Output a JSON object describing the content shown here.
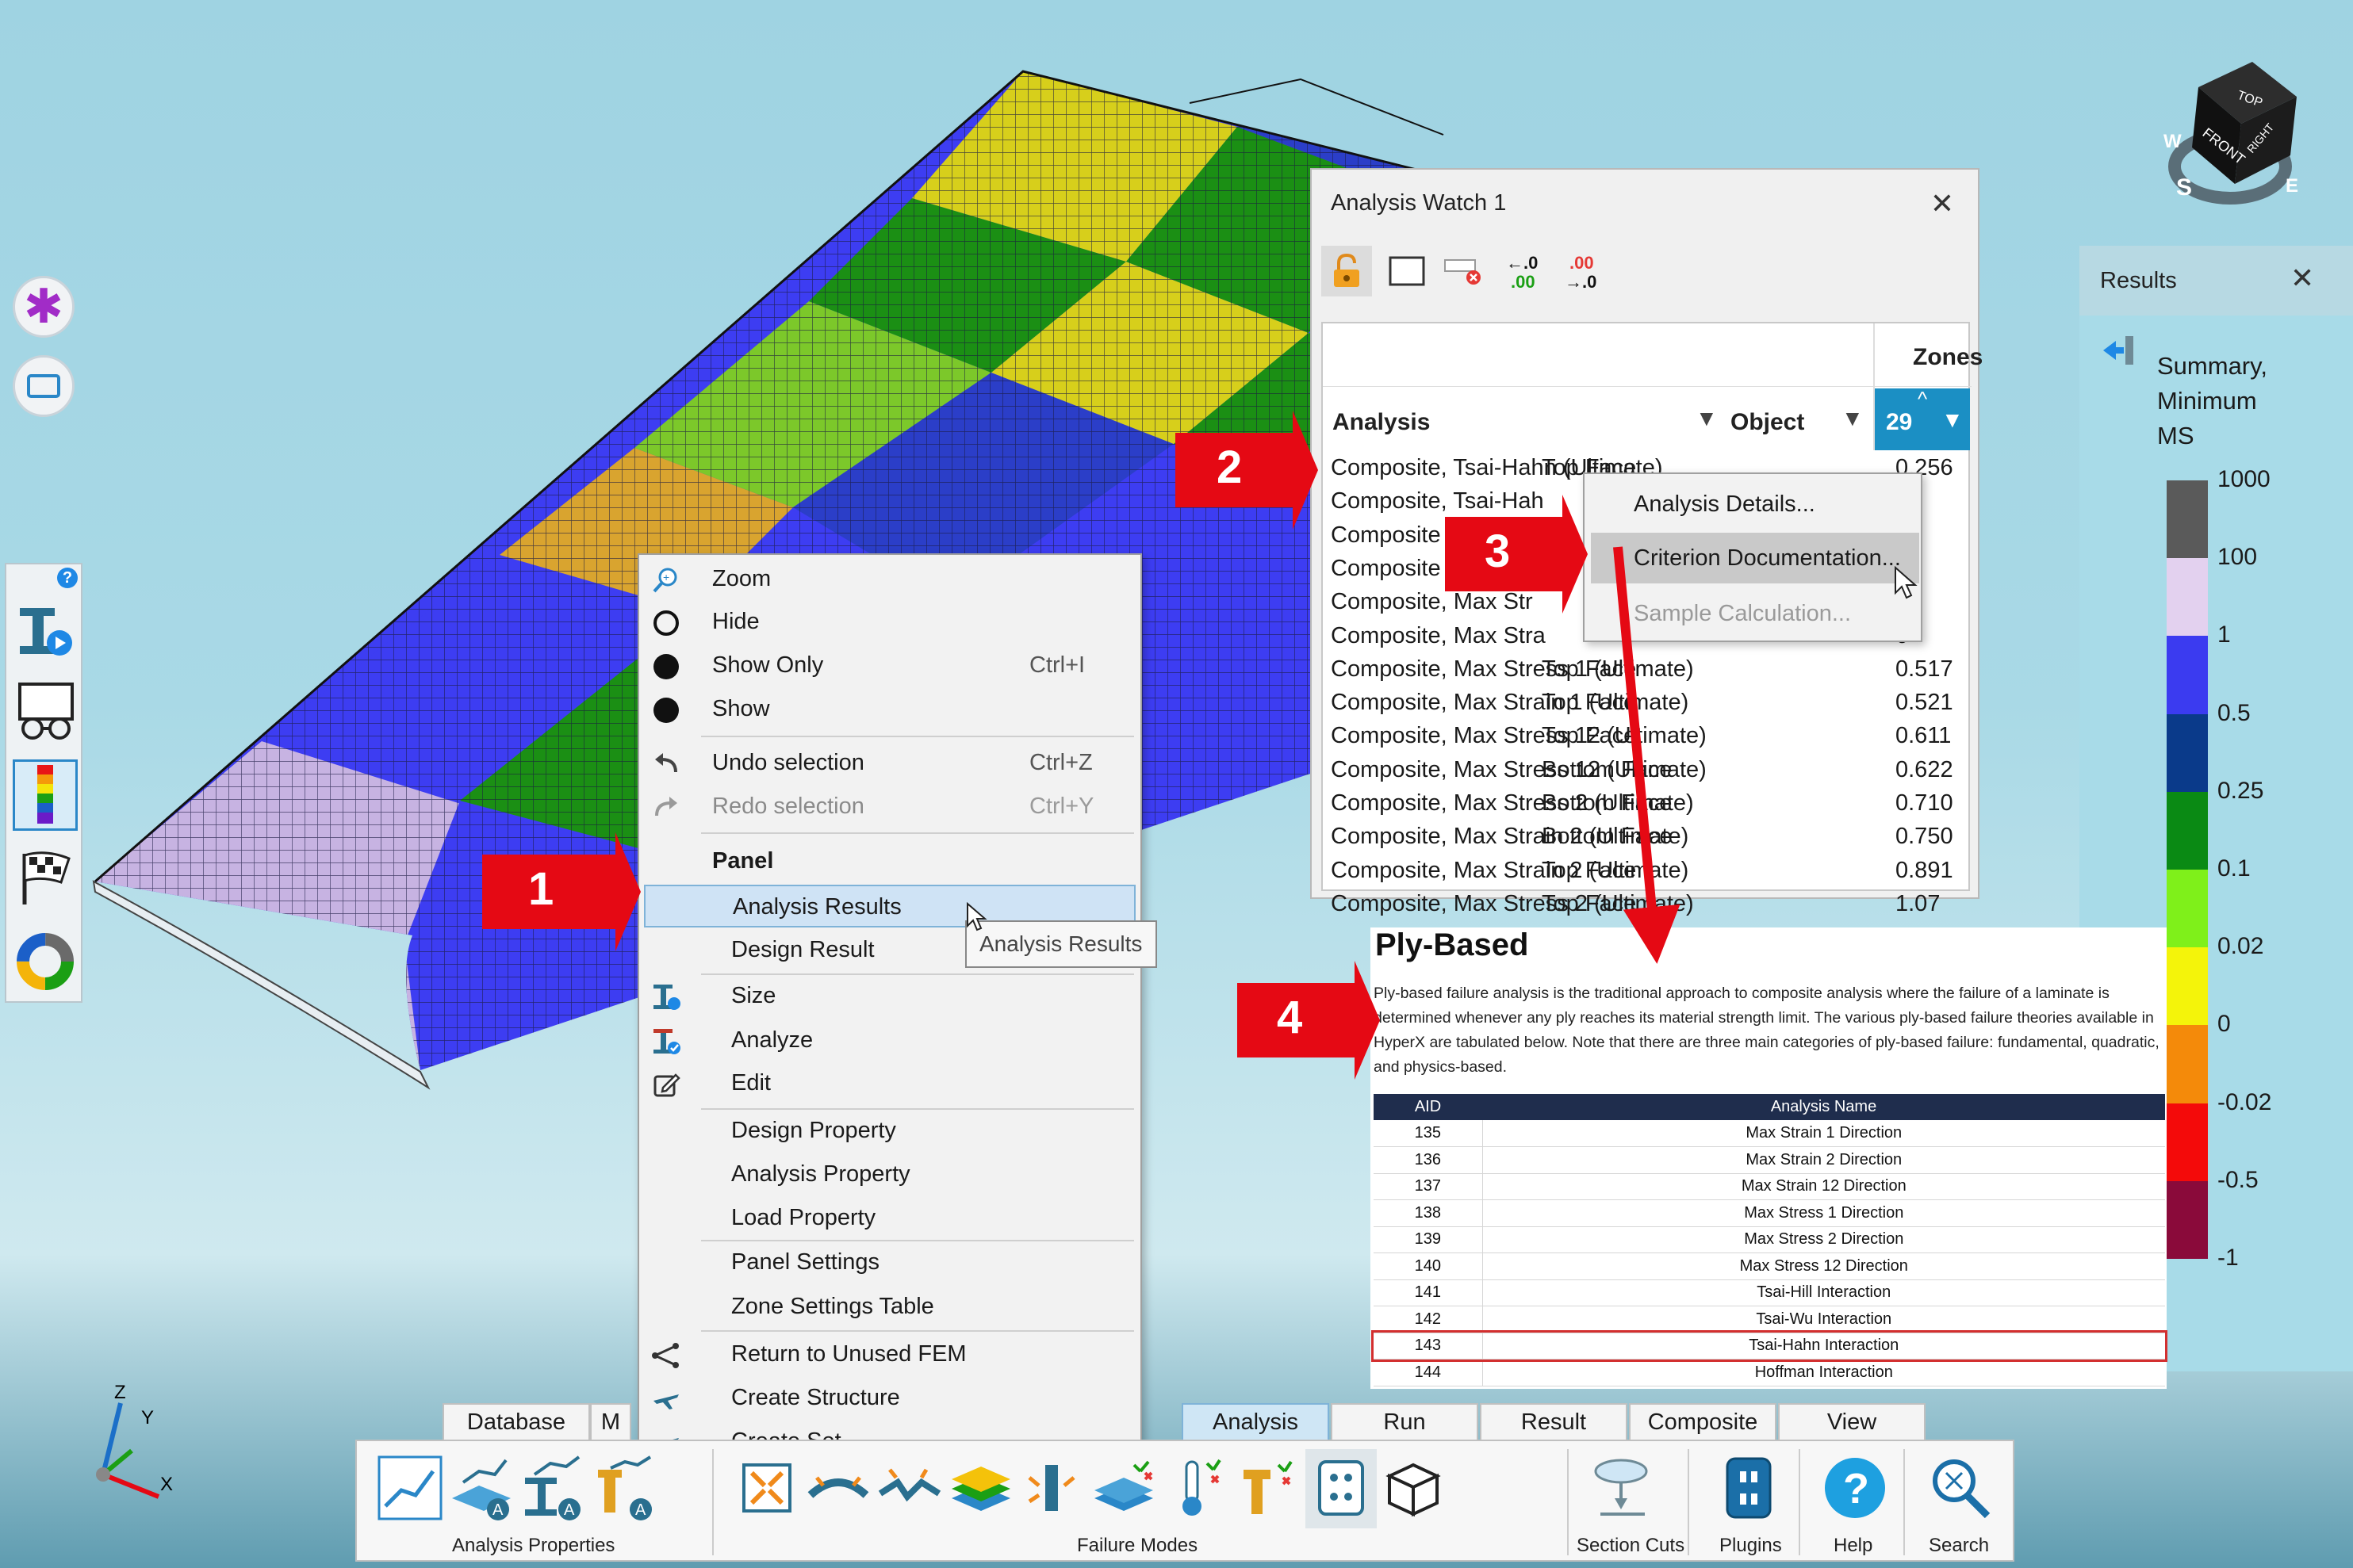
{
  "watch": {
    "title": "Analysis Watch 1",
    "close": "✕",
    "col_zones": "Zones",
    "col_analysis": "Analysis",
    "col_object": "Object",
    "zone_number": "29",
    "rows": [
      {
        "analysis": "Composite, Tsai-Hahn (Ultimate)",
        "object": "Top Face",
        "value": "0.256"
      },
      {
        "analysis": "Composite, Tsai-Hah",
        "object": "",
        "value": "8"
      },
      {
        "analysis": "Composite",
        "object": "",
        "value": "9"
      },
      {
        "analysis": "Composite",
        "object": "",
        "value": "8"
      },
      {
        "analysis": "Composite, Max Str",
        "object": "",
        "value": "5"
      },
      {
        "analysis": "Composite, Max Stra",
        "object": "",
        "value": "6"
      },
      {
        "analysis": "Composite, Max Stress 1 (Ultimate)",
        "object": "Top Face",
        "value": "0.517"
      },
      {
        "analysis": "Composite, Max Strain 1 (Ultimate)",
        "object": "Top Face",
        "value": "0.521"
      },
      {
        "analysis": "Composite, Max Stress 12 (Ultimate)",
        "object": "Top Face",
        "value": "0.611"
      },
      {
        "analysis": "Composite, Max Stress 12 (Ultimate)",
        "object": "Bottom Face",
        "value": "0.622"
      },
      {
        "analysis": "Composite, Max Stress 2 (Ultimate)",
        "object": "Bottom Face",
        "value": "0.710"
      },
      {
        "analysis": "Composite, Max Strain 2 (Ultimate)",
        "object": "Bottom Face",
        "value": "0.750"
      },
      {
        "analysis": "Composite, Max Strain 2 (Ultimate)",
        "object": "Top Face",
        "value": "0.891"
      },
      {
        "analysis": "Composite, Max Stress 2 (Ultimate)",
        "object": "Top Face",
        "value": "1.07"
      }
    ]
  },
  "submenu": {
    "items": [
      "Analysis Details...",
      "Criterion Documentation...",
      "Sample Calculation..."
    ]
  },
  "context_menu": {
    "zoom": "Zoom",
    "hide": "Hide",
    "show_only": "Show Only",
    "show_only_sc": "Ctrl+I",
    "show": "Show",
    "undo": "Undo selection",
    "undo_sc": "Ctrl+Z",
    "redo": "Redo selection",
    "redo_sc": "Ctrl+Y",
    "panel_header": "Panel",
    "analysis_results": "Analysis Results",
    "design_result": "Design Result",
    "size": "Size",
    "analyze": "Analyze",
    "edit": "Edit",
    "design_property": "Design Property",
    "analysis_property": "Analysis Property",
    "load_property": "Load Property",
    "panel_settings": "Panel Settings",
    "zone_settings_table": "Zone Settings Table",
    "return_unused_fem": "Return to Unused FEM",
    "create_structure": "Create Structure",
    "create_set": "Create Set"
  },
  "tooltip": "Analysis Results",
  "results": {
    "title": "Results",
    "close": "✕",
    "summary": [
      "Summary,",
      "Minimum",
      "MS"
    ],
    "legend": [
      {
        "label": "1000",
        "color": "#5a5a5a"
      },
      {
        "label": "100",
        "color": "#e3d1ef"
      },
      {
        "label": "1",
        "color": "#3b3bf0"
      },
      {
        "label": "0.5",
        "color": "#0a3a8a"
      },
      {
        "label": "0.25",
        "color": "#0a8a14"
      },
      {
        "label": "0.1",
        "color": "#7ff01a"
      },
      {
        "label": "0.02",
        "color": "#f4f40a"
      },
      {
        "label": "0",
        "color": "#f48a0a"
      },
      {
        "label": "-0.02",
        "color": "#f40a0a"
      },
      {
        "label": "-0.5",
        "color": "#8a0a3a"
      },
      {
        "label": "-1",
        "color": ""
      }
    ]
  },
  "doc": {
    "title": "Ply-Based",
    "body": "Ply-based failure analysis is the traditional approach to composite analysis where the failure of a laminate is determined whenever any ply reaches its material strength limit. The various ply-based failure theories available in HyperX are tabulated below. Note that there are three main categories of ply-based failure: fundamental, quadratic, and physics-based.",
    "col_aid": "AID",
    "col_name": "Analysis Name",
    "rows": [
      {
        "aid": "135",
        "name": "Max Strain 1 Direction"
      },
      {
        "aid": "136",
        "name": "Max Strain 2 Direction"
      },
      {
        "aid": "137",
        "name": "Max Strain 12 Direction"
      },
      {
        "aid": "138",
        "name": "Max Stress 1 Direction"
      },
      {
        "aid": "139",
        "name": "Max Stress 2 Direction"
      },
      {
        "aid": "140",
        "name": "Max Stress 12 Direction"
      },
      {
        "aid": "141",
        "name": "Tsai-Hill Interaction"
      },
      {
        "aid": "142",
        "name": "Tsai-Wu Interaction"
      },
      {
        "aid": "143",
        "name": "Tsai-Hahn Interaction"
      },
      {
        "aid": "144",
        "name": "Hoffman Interaction"
      }
    ]
  },
  "ribbon": {
    "tabs": [
      "Database",
      "M",
      "Analysis",
      "Run",
      "Result",
      "Composite",
      "View"
    ],
    "active_tab": "Analysis",
    "groups": {
      "analysis_properties": "Analysis Properties",
      "failure_modes": "Failure Modes",
      "section_cuts": "Section Cuts",
      "plugins": "Plugins",
      "help": "Help",
      "search": "Search"
    }
  },
  "callouts": [
    "1",
    "2",
    "3",
    "4"
  ],
  "view_cube": {
    "top": "TOP",
    "front": "FRONT",
    "right": "RIGHT",
    "w": "W",
    "s": "S",
    "e": "E"
  },
  "axes": {
    "z": "Z",
    "y": "Y",
    "x": "X"
  },
  "colors": {
    "callout_red": "#e50914",
    "highlight": "#cfe3f5",
    "zones_header": "#1b8fc4",
    "doc_table_header": "#1f2d4d"
  }
}
